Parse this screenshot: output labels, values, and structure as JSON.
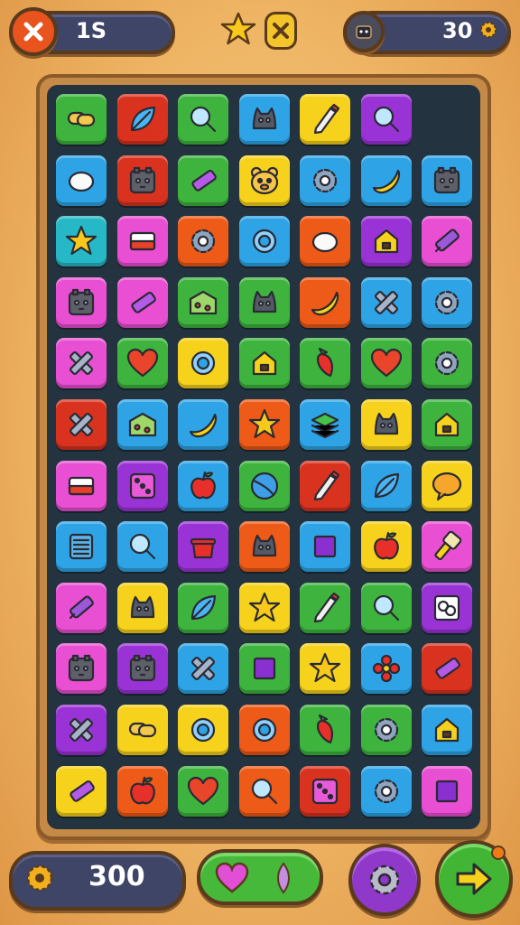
{
  "top_bar": {
    "timer": "1S",
    "coins": "30",
    "close_icon": "close-icon",
    "star_icon": "star-icon",
    "shuffle_icon": "cross-badge-icon",
    "avatar_icon": "player-avatar-icon",
    "coin_icon": "gear-coin-icon"
  },
  "bottom_bar": {
    "gear_count": "300",
    "gear_icon": "gear-coin-icon",
    "heart_icon": "heart-icon",
    "leaf_icon": "leaf-icon",
    "settings_icon": "gear-icon",
    "next_icon": "arrow-right-icon"
  },
  "colors": {
    "green": "#3eb43e",
    "red": "#d9331f",
    "blue": "#2ea4e6",
    "yellow": "#f6d21c",
    "purple": "#9a33d6",
    "pink": "#e84fd2",
    "orange": "#ee5a17",
    "teal": "#27b8c7",
    "board": "#23333f",
    "frame": "#c58a45"
  },
  "board": {
    "rows": [
      [
        {
          "c": "green",
          "i": "chain"
        },
        {
          "c": "red",
          "i": "leaf"
        },
        {
          "c": "green",
          "i": "magnifier"
        },
        {
          "c": "blue",
          "i": "cat"
        },
        {
          "c": "yellow",
          "i": "pencil"
        },
        {
          "c": "purple",
          "i": "magnifier"
        },
        {
          "c": "",
          "i": ""
        }
      ],
      [
        {
          "c": "blue",
          "i": "egg"
        },
        {
          "c": "red",
          "i": "face"
        },
        {
          "c": "green",
          "i": "tube"
        },
        {
          "c": "yellow",
          "i": "bear"
        },
        {
          "c": "blue",
          "i": "gear"
        },
        {
          "c": "blue",
          "i": "banana"
        },
        {
          "c": "blue",
          "i": "face"
        }
      ],
      [
        {
          "c": "teal",
          "i": "star"
        },
        {
          "c": "pink",
          "i": "flag"
        },
        {
          "c": "orange",
          "i": "gear"
        },
        {
          "c": "blue",
          "i": "ring"
        },
        {
          "c": "orange",
          "i": "egg"
        },
        {
          "c": "purple",
          "i": "house"
        },
        {
          "c": "pink",
          "i": "marker"
        }
      ],
      [
        {
          "c": "pink",
          "i": "face"
        },
        {
          "c": "pink",
          "i": "tube"
        },
        {
          "c": "green",
          "i": "box"
        },
        {
          "c": "green",
          "i": "cat"
        },
        {
          "c": "orange",
          "i": "banana"
        },
        {
          "c": "blue",
          "i": "cross"
        },
        {
          "c": "blue",
          "i": "gear"
        }
      ],
      [
        {
          "c": "pink",
          "i": "cross"
        },
        {
          "c": "green",
          "i": "heart"
        },
        {
          "c": "yellow",
          "i": "ring"
        },
        {
          "c": "green",
          "i": "house"
        },
        {
          "c": "green",
          "i": "pepper"
        },
        {
          "c": "green",
          "i": "heart"
        },
        {
          "c": "green",
          "i": "gear"
        }
      ],
      [
        {
          "c": "red",
          "i": "cross"
        },
        {
          "c": "blue",
          "i": "box"
        },
        {
          "c": "blue",
          "i": "banana"
        },
        {
          "c": "orange",
          "i": "star"
        },
        {
          "c": "blue",
          "i": "stack"
        },
        {
          "c": "yellow",
          "i": "cat"
        },
        {
          "c": "green",
          "i": "house"
        }
      ],
      [
        {
          "c": "pink",
          "i": "flag"
        },
        {
          "c": "purple",
          "i": "dice"
        },
        {
          "c": "blue",
          "i": "apple"
        },
        {
          "c": "green",
          "i": "ball"
        },
        {
          "c": "red",
          "i": "pencil"
        },
        {
          "c": "blue",
          "i": "leaf"
        },
        {
          "c": "yellow",
          "i": "bubble"
        }
      ],
      [
        {
          "c": "blue",
          "i": "grid"
        },
        {
          "c": "blue",
          "i": "magnifier"
        },
        {
          "c": "purple",
          "i": "pot"
        },
        {
          "c": "orange",
          "i": "cat"
        },
        {
          "c": "blue",
          "i": "square"
        },
        {
          "c": "yellow",
          "i": "apple"
        },
        {
          "c": "pink",
          "i": "brush"
        }
      ],
      [
        {
          "c": "pink",
          "i": "marker"
        },
        {
          "c": "yellow",
          "i": "cat"
        },
        {
          "c": "green",
          "i": "leaf"
        },
        {
          "c": "yellow",
          "i": "star"
        },
        {
          "c": "green",
          "i": "pencil"
        },
        {
          "c": "green",
          "i": "magnifier"
        },
        {
          "c": "purple",
          "i": "links"
        }
      ],
      [
        {
          "c": "pink",
          "i": "face"
        },
        {
          "c": "purple",
          "i": "face"
        },
        {
          "c": "blue",
          "i": "cross"
        },
        {
          "c": "green",
          "i": "square"
        },
        {
          "c": "yellow",
          "i": "star"
        },
        {
          "c": "blue",
          "i": "flower"
        },
        {
          "c": "red",
          "i": "tube"
        }
      ],
      [
        {
          "c": "purple",
          "i": "cross"
        },
        {
          "c": "yellow",
          "i": "chain"
        },
        {
          "c": "yellow",
          "i": "ring"
        },
        {
          "c": "orange",
          "i": "ring"
        },
        {
          "c": "green",
          "i": "pepper"
        },
        {
          "c": "green",
          "i": "gear"
        },
        {
          "c": "blue",
          "i": "house"
        }
      ],
      [
        {
          "c": "yellow",
          "i": "tube"
        },
        {
          "c": "orange",
          "i": "apple"
        },
        {
          "c": "green",
          "i": "heart"
        },
        {
          "c": "orange",
          "i": "magnifier"
        },
        {
          "c": "red",
          "i": "dice"
        },
        {
          "c": "blue",
          "i": "gear"
        },
        {
          "c": "pink",
          "i": "square"
        }
      ]
    ]
  }
}
